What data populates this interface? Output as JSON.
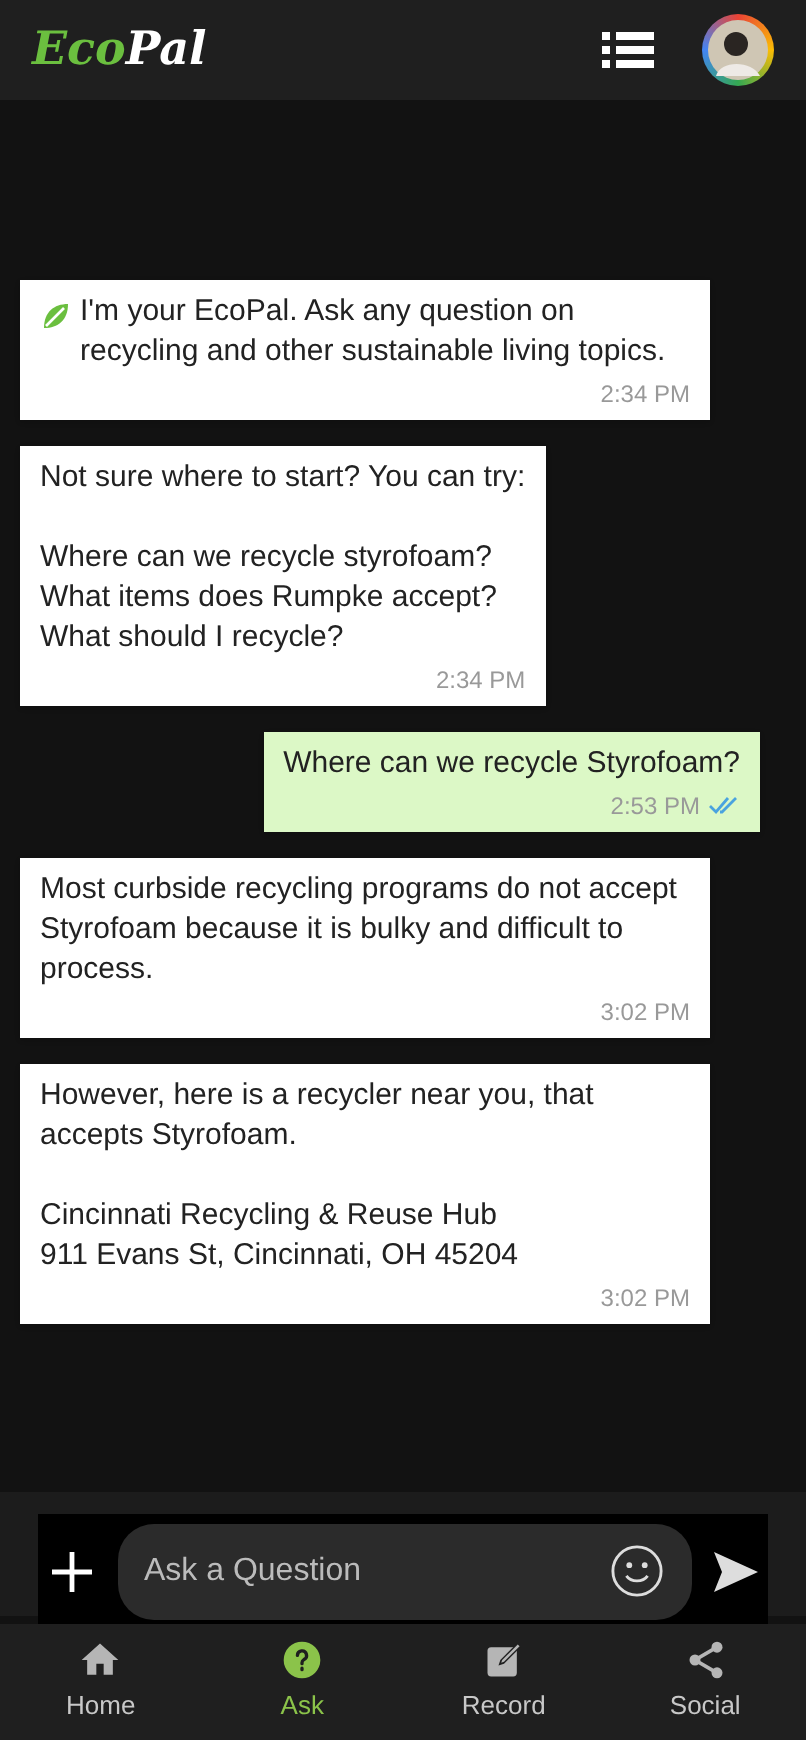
{
  "header": {
    "logo_green": "Eco",
    "logo_white": "Pal"
  },
  "messages": [
    {
      "kind": "bot",
      "leaf": true,
      "text": "I'm your EcoPal. Ask any question on recycling and other sustainable living topics.",
      "time": "2:34 PM"
    },
    {
      "kind": "bot",
      "leaf": false,
      "text": "Not sure where to start? You can try:\n\nWhere can we recycle styrofoam?\nWhat items does Rumpke accept?\nWhat should I recycle?",
      "time": "2:34 PM"
    },
    {
      "kind": "user",
      "read": true,
      "text": "Where can we recycle Styrofoam?",
      "time": "2:53 PM"
    },
    {
      "kind": "bot",
      "leaf": false,
      "text": "Most curbside recycling programs do not accept Styrofoam because it is bulky and difficult to process.",
      "time": "3:02 PM"
    },
    {
      "kind": "bot",
      "leaf": false,
      "text": "However, here is a recycler near you, that accepts Styrofoam.\n\nCincinnati Recycling & Reuse Hub\n911 Evans St, Cincinnati, OH 45204",
      "time": "3:02 PM"
    }
  ],
  "composer": {
    "placeholder": "Ask a Question"
  },
  "nav": [
    {
      "kind": "home",
      "label": "Home",
      "selected": false
    },
    {
      "kind": "ask",
      "label": "Ask",
      "selected": true
    },
    {
      "kind": "record",
      "label": "Record",
      "selected": false
    },
    {
      "kind": "social",
      "label": "Social",
      "selected": false
    }
  ]
}
